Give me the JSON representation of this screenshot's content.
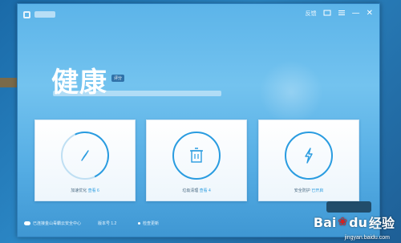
{
  "window": {
    "title_controls": {
      "menu_label": "反馈",
      "skin_icon": "skin-icon",
      "menu_icon": "menu-icon",
      "minimize_glyph": "—",
      "close_glyph": "✕"
    }
  },
  "hero": {
    "title": "健康",
    "badge": "评分"
  },
  "cards": [
    {
      "icon": "compass-icon",
      "label": "加速优化",
      "link": "查看 6"
    },
    {
      "icon": "trash-icon",
      "label": "垃圾清理",
      "link": "查看 4"
    },
    {
      "icon": "lightning-icon",
      "label": "安全防护",
      "link": "已开启"
    }
  ],
  "footer": {
    "item_1": "已连接金山毒霸云安全中心",
    "item_2": "版本号 1.2",
    "item_3": "检查更新"
  },
  "watermark": {
    "brand_a": "Bai",
    "brand_b": "du",
    "brand_c": "经验",
    "url": "jingyan.baidu.com"
  },
  "colors": {
    "accent": "#2a9ce0",
    "window_bg": "#5cb4e9",
    "watermark_paw": "#d82020"
  }
}
